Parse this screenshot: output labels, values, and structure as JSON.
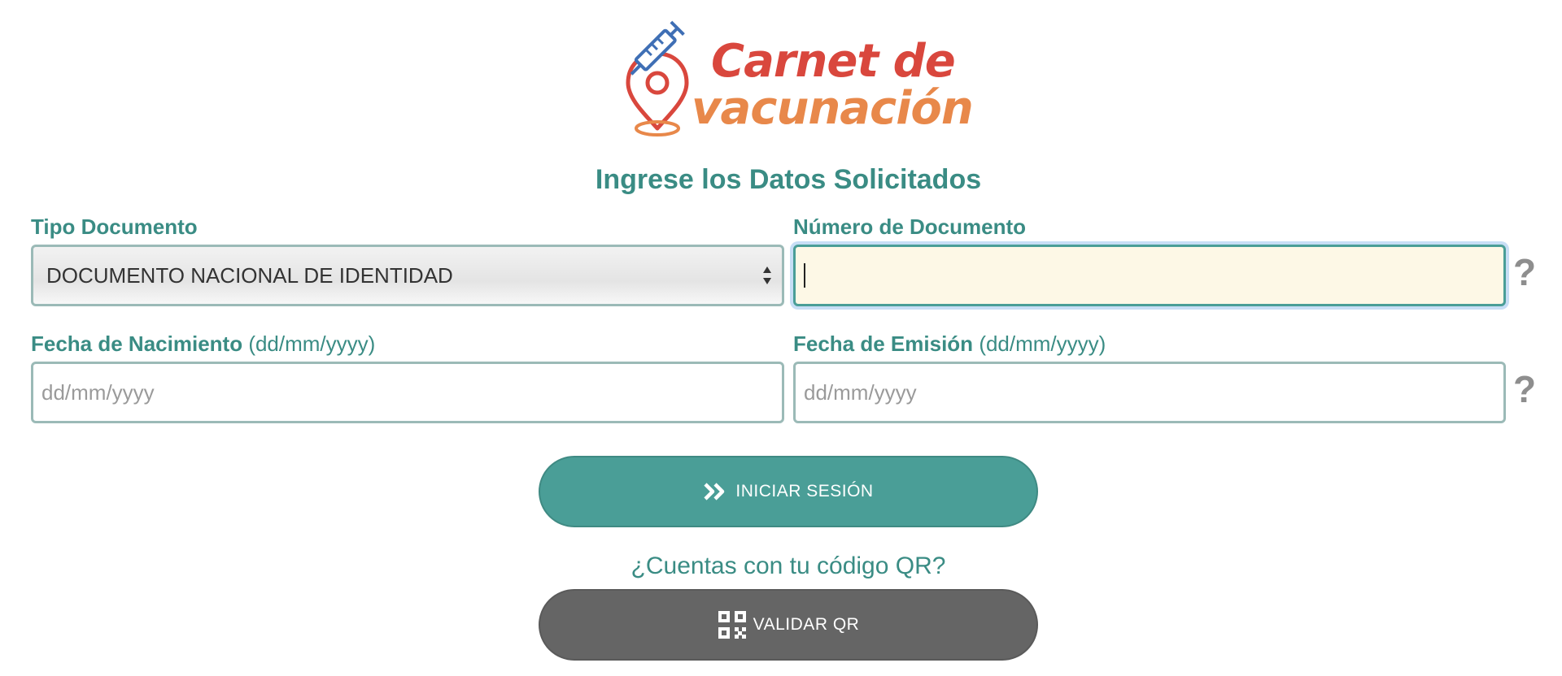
{
  "logo": {
    "line1": "Carnet de",
    "line2": "vacunación"
  },
  "form": {
    "title": "Ingrese los Datos Solicitados",
    "tipo_documento": {
      "label": "Tipo Documento",
      "value": "DOCUMENTO NACIONAL DE IDENTIDAD"
    },
    "numero_documento": {
      "label": "Número de Documento",
      "value": ""
    },
    "fecha_nacimiento": {
      "label": "Fecha de Nacimiento",
      "hint": "(dd/mm/yyyy)",
      "placeholder": "dd/mm/yyyy"
    },
    "fecha_emision": {
      "label": "Fecha de Emisión",
      "hint": "(dd/mm/yyyy)",
      "placeholder": "dd/mm/yyyy"
    },
    "help_symbol": "?"
  },
  "buttons": {
    "login_label": "INICIAR SESIÓN",
    "qr_question": "¿Cuentas con tu código QR?",
    "qr_label": "VALIDAR QR"
  },
  "colors": {
    "accent": "#4a9e97",
    "label": "#3a8c84",
    "logo_red": "#d9473d",
    "logo_orange": "#e8884a",
    "qr_button": "#656565",
    "active_field_bg": "#fdf8e6"
  },
  "icons": {
    "logo": "syringe-location-pin-icon",
    "login": "double-chevron-right-icon",
    "qr": "qr-code-icon",
    "select": "select-arrows-icon",
    "help": "question-mark-icon"
  }
}
